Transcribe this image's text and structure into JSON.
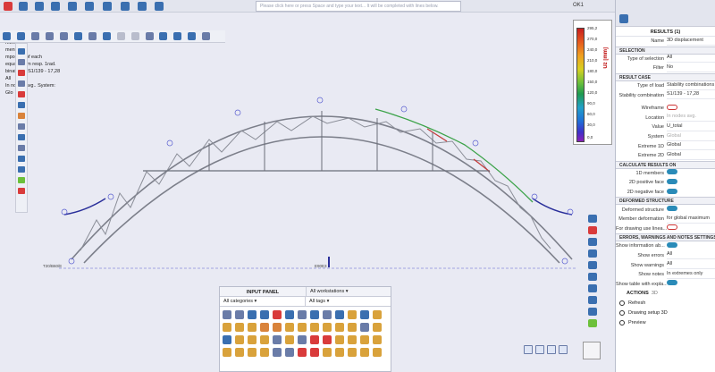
{
  "command_placeholder": "Please click here or press Space and type your text... It will be completed with lines below.",
  "status_ok": "OK1",
  "info": {
    "line1": "ment",
    "line2": "ment",
    "line3": "mponent of each",
    "line4": "equal to 1m resp. 1rad.",
    "line5": "binations: S1/139 - 17,28",
    "line6": "All",
    "line7": "In nodes avg.. System:",
    "line8": "Glo"
  },
  "legend": {
    "unit": "Uz [mm]",
    "values": [
      "295,2",
      "270,0",
      "240,0",
      "210,0",
      "180,0",
      "150,0",
      "120,0",
      "90,0",
      "60,0",
      "30,0",
      "0,0"
    ]
  },
  "labels": {
    "left_support": "T20/B60/E",
    "mid_node": "E90E3"
  },
  "input_panel": {
    "title": "INPUT PANEL",
    "workstations": "All workstations",
    "categories": "All categories",
    "tags": "All tags"
  },
  "results": {
    "header": "RESULTS (1)",
    "name_label": "Name",
    "name_value": "3D displacement",
    "selection_section": "SELECTION",
    "type_selection_label": "Type of selection",
    "type_selection_value": "All",
    "filter_label": "Filter",
    "filter_value": "No",
    "result_case_section": "RESULT CASE",
    "type_load_label": "Type of load",
    "type_load_value": "Stability combinations",
    "stability_label": "Stability combination",
    "stability_value": "S1/139 - 17,28",
    "wireframe_label": "Wireframe",
    "location_label": "Location",
    "location_value": "In nodes avg.",
    "value_label": "Value",
    "value_value": "U_total",
    "system_label": "System",
    "system_value": "Global",
    "extreme1d_label": "Extreme 1D",
    "extreme1d_value": "Global",
    "extreme2d_label": "Extreme 2D",
    "extreme2d_value": "Global",
    "calculate_section": "CALCULATE RESULTS ON",
    "members1d_label": "1D members",
    "positive2d_label": "2D positive face",
    "negative2d_label": "2D negative face",
    "deformed_section": "DEFORMED STRUCTURE",
    "deformed_label": "Deformed structure",
    "member_def_label": "Member deformation",
    "member_def_value": "for global maximum",
    "drawing_label": "For drawing use linea...",
    "errors_section": "ERRORS, WARNINGS AND NOTES SETTINGS",
    "show_info_label": "Show information ab...",
    "show_errors_label": "Show errors",
    "show_errors_value": "All",
    "show_warnings_label": "Show warnings",
    "show_warnings_value": "All",
    "show_notes_label": "Show notes",
    "show_notes_value": "In extremes only",
    "show_table_label": "Show table with expla...",
    "actions_label": "ACTIONS",
    "actions_count": "3D",
    "refresh": "Refresh",
    "drawing_setup": "Drawing setup 3D",
    "preview": "Preview"
  },
  "colors": {
    "structure": "#7c7f8a",
    "deformed": "#2a2f9a",
    "accent": "#2a8bb8"
  }
}
